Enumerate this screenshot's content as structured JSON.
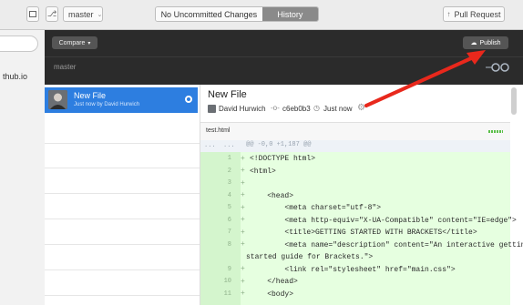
{
  "toolbar": {
    "branch_label": "master",
    "tab_uncommitted": "No Uncommitted Changes",
    "tab_history": "History",
    "pull_request": "Pull Request"
  },
  "sidebar": {
    "repo_name": "thub.io"
  },
  "header": {
    "compare_label": "Compare",
    "publish_label": "Publish",
    "branch": "master"
  },
  "commit_list": [
    {
      "title": "New File",
      "subtitle": "Just now by David Hurwich",
      "selected": true
    }
  ],
  "commit_detail": {
    "title": "New File",
    "author": "David Hurwich",
    "sha": "c6eb0b3",
    "time": "Just now",
    "file_name": "test.html",
    "hunk_header": "@@ -0,0 +1,187 @@",
    "lines": [
      {
        "num": "1",
        "text": "<!DOCTYPE html>"
      },
      {
        "num": "2",
        "text": "<html>"
      },
      {
        "num": "3",
        "text": ""
      },
      {
        "num": "4",
        "text": "    <head>"
      },
      {
        "num": "5",
        "text": "        <meta charset=\"utf-8\">"
      },
      {
        "num": "6",
        "text": "        <meta http-equiv=\"X-UA-Compatible\" content=\"IE=edge\">"
      },
      {
        "num": "7",
        "text": "        <title>GETTING STARTED WITH BRACKETS</title>"
      },
      {
        "num": "8",
        "text": "        <meta name=\"description\" content=\"An interactive getting"
      },
      {
        "num": "",
        "text": "started guide for Brackets.\">"
      },
      {
        "num": "9",
        "text": "        <link rel=\"stylesheet\" href=\"main.css\">"
      },
      {
        "num": "10",
        "text": "    </head>"
      },
      {
        "num": "11",
        "text": "    <body>"
      }
    ]
  },
  "colors": {
    "accent_blue": "#2d7ee0",
    "arrow_red": "#e8281c",
    "added_bg": "#e6ffe0",
    "dark_header": "#2b2b2b"
  }
}
